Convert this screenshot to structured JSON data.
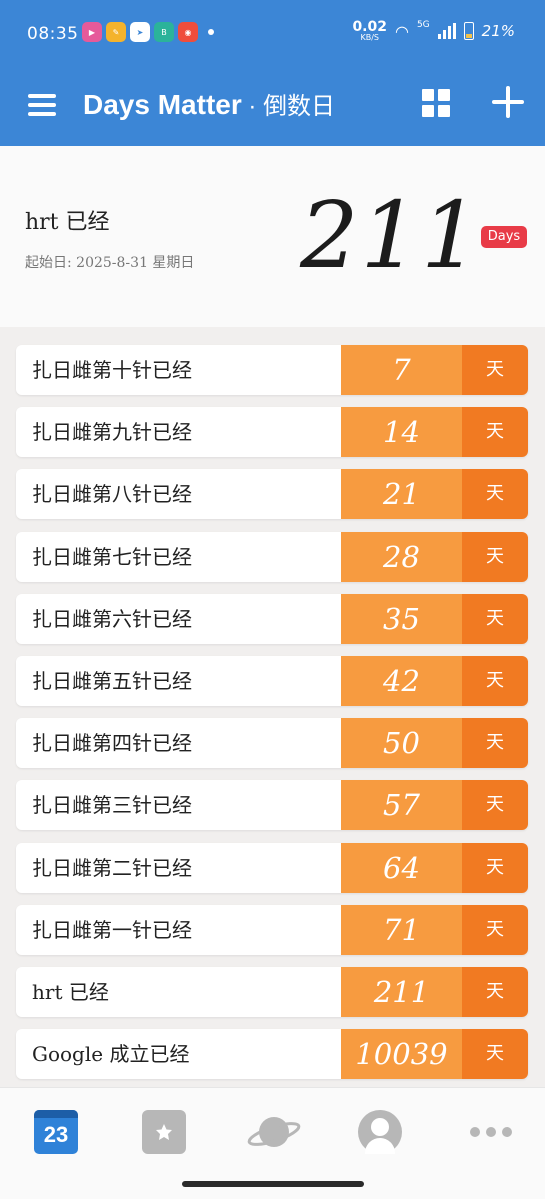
{
  "status_bar": {
    "time": "08:35",
    "net_speed": "0.02",
    "net_unit": "KB/S",
    "net_type": "5G",
    "battery": "21%"
  },
  "header": {
    "title": "Days Matter",
    "subtitle": " · 倒数日"
  },
  "top_event": {
    "title": "hrt 已经",
    "start": "起始日: 2025-8-31 星期日",
    "days": "211",
    "badge": "Days"
  },
  "events": [
    {
      "name": "扎日雌第十针已经",
      "days": "7",
      "unit": "天"
    },
    {
      "name": "扎日雌第九针已经",
      "days": "14",
      "unit": "天"
    },
    {
      "name": "扎日雌第八针已经",
      "days": "21",
      "unit": "天"
    },
    {
      "name": "扎日雌第七针已经",
      "days": "28",
      "unit": "天"
    },
    {
      "name": "扎日雌第六针已经",
      "days": "35",
      "unit": "天"
    },
    {
      "name": "扎日雌第五针已经",
      "days": "42",
      "unit": "天"
    },
    {
      "name": "扎日雌第四针已经",
      "days": "50",
      "unit": "天"
    },
    {
      "name": "扎日雌第三针已经",
      "days": "57",
      "unit": "天"
    },
    {
      "name": "扎日雌第二针已经",
      "days": "64",
      "unit": "天"
    },
    {
      "name": "扎日雌第一针已经",
      "days": "71",
      "unit": "天"
    },
    {
      "name": "hrt 已经",
      "days": "211",
      "unit": "天"
    },
    {
      "name": "Google 成立已经",
      "days": "10039",
      "unit": "天"
    }
  ],
  "bottom_nav": {
    "calendar_day": "23"
  },
  "colors": {
    "header": "#3c86d6",
    "num_cell": "#f79b40",
    "unit_cell": "#f17a22",
    "badge": "#e83b47"
  }
}
